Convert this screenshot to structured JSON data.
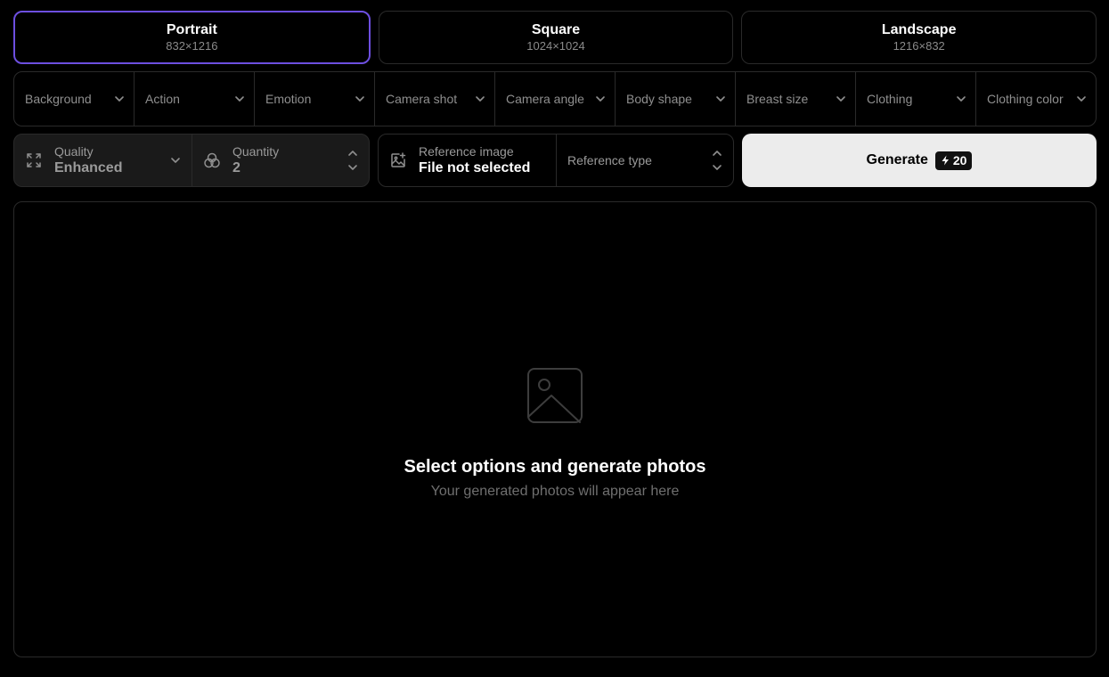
{
  "ratios": [
    {
      "label": "Portrait",
      "size": "832×1216"
    },
    {
      "label": "Square",
      "size": "1024×1024"
    },
    {
      "label": "Landscape",
      "size": "1216×832"
    }
  ],
  "filters": [
    "Background",
    "Action",
    "Emotion",
    "Camera shot",
    "Camera angle",
    "Body shape",
    "Breast size",
    "Clothing",
    "Clothing color"
  ],
  "quality": {
    "label": "Quality",
    "value": "Enhanced",
    "icon": "expand-icon"
  },
  "quantity": {
    "label": "Quantity",
    "value": "2",
    "icon": "circles-icon"
  },
  "reference_image": {
    "label": "Reference image",
    "value": "File not selected",
    "icon": "image-add-icon"
  },
  "reference_type": {
    "label": "Reference type"
  },
  "generate": {
    "label": "Generate",
    "cost": "20",
    "icon": "bolt-icon"
  },
  "empty_state": {
    "icon": "image-placeholder-icon",
    "title": "Select options and generate photos",
    "subtitle": "Your generated photos will appear here"
  },
  "colors": {
    "accent": "#6d4fe0",
    "generate_bg": "#ececec",
    "border": "#2a2a2a"
  }
}
